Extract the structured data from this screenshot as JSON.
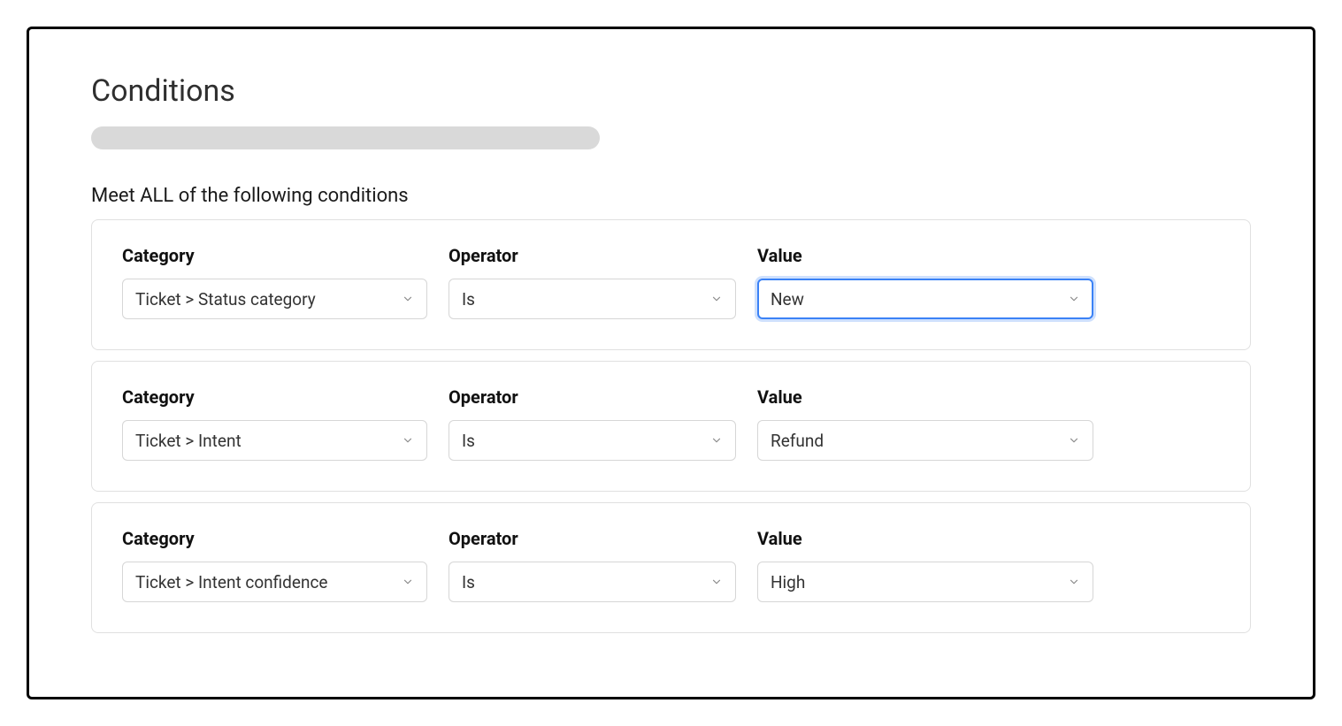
{
  "title": "Conditions",
  "subtitle": "Meet ALL of the following conditions",
  "labels": {
    "category": "Category",
    "operator": "Operator",
    "value": "Value"
  },
  "rows": [
    {
      "category": "Ticket > Status category",
      "operator": "Is",
      "value": "New",
      "value_focused": true
    },
    {
      "category": "Ticket > Intent",
      "operator": "Is",
      "value": "Refund",
      "value_focused": false
    },
    {
      "category": "Ticket > Intent confidence",
      "operator": "Is",
      "value": "High",
      "value_focused": false
    }
  ]
}
